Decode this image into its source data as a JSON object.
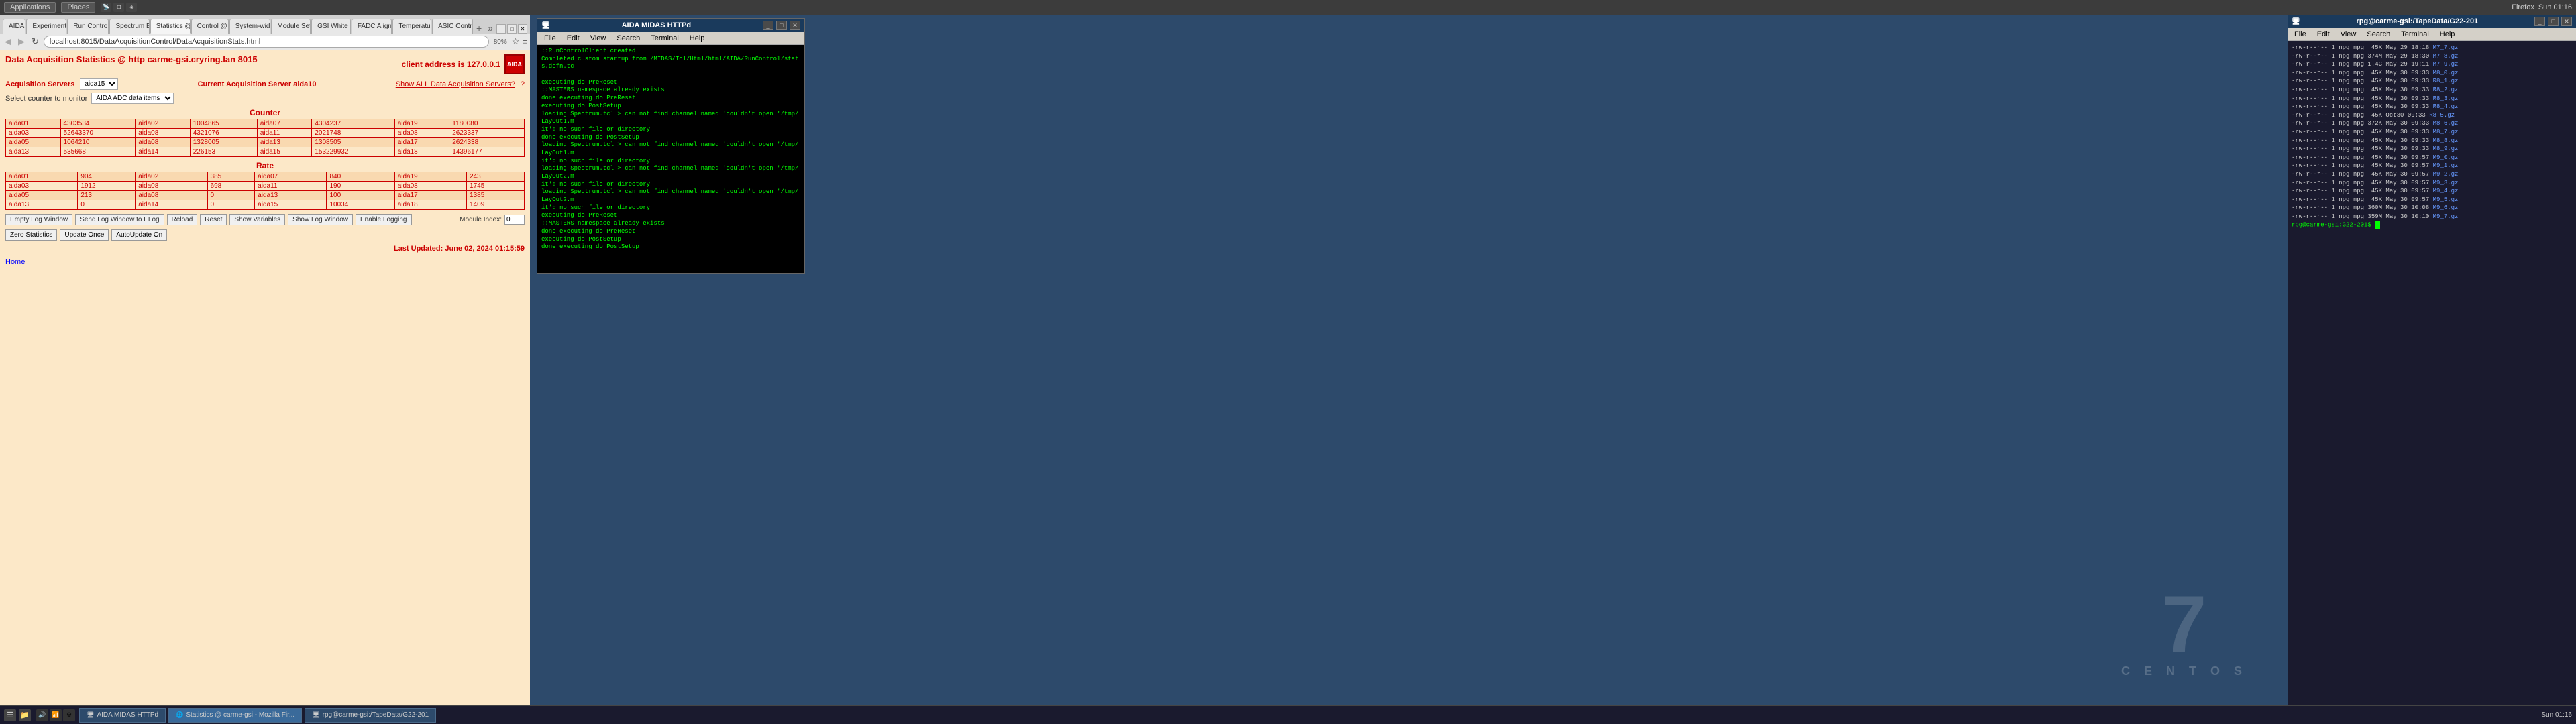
{
  "topbar": {
    "time": "Sun 01:16",
    "apps_label": "Applications",
    "places_label": "Places",
    "firefox_label": "Firefox"
  },
  "browser": {
    "tabs": [
      {
        "label": "AIDA",
        "active": false
      },
      {
        "label": "Experiment Cor...",
        "active": false
      },
      {
        "label": "Run Control @ c...",
        "active": false
      },
      {
        "label": "Spectrum Brow...",
        "active": false
      },
      {
        "label": "Statistics @ car...",
        "active": true
      },
      {
        "label": "Control @ car...",
        "active": false
      },
      {
        "label": "System-wide Ch...",
        "active": false
      },
      {
        "label": "Module Setting...",
        "active": false
      },
      {
        "label": "GSI White Rab...",
        "active": false
      },
      {
        "label": "FADC Align & C...",
        "active": false
      },
      {
        "label": "Temperature a...",
        "active": false
      },
      {
        "label": "ASIC Control @...",
        "active": false
      }
    ],
    "url": "localhost:8015/DataAcquisitionControl/DataAcquisitionStats.html",
    "zoom": "80%",
    "page_title": "Data Acquisition Statistics @ http carme-gsi.cryring.lan 8015",
    "client_address_label": "client address is 127.0.0.1",
    "acq_servers_label": "Acquisition Servers",
    "acq_server_value": "aida15",
    "current_server_label": "Current Acquisition Server aida10",
    "show_all_label": "Show ALL Data Acquisition Servers?",
    "monitor_label": "Select counter to monitor",
    "monitor_select": "AIDA ADC data items",
    "counter_section": "Counter",
    "rate_section": "Rate",
    "counter_rows": [
      [
        "aida01",
        "4303534",
        "aida02",
        "1004865",
        "aida07",
        "4304237",
        "aida19",
        "1180080"
      ],
      [
        "aida03",
        "52643370",
        "aida08",
        "4321076",
        "aida11",
        "2021748",
        "aida08",
        "2623337"
      ],
      [
        "aida05",
        "1064210",
        "aida08",
        "1328005",
        "aida13",
        "1308505",
        "aida17",
        "2624338"
      ],
      [
        "aida13",
        "535668",
        "aida14",
        "226153",
        "aida15",
        "153229932",
        "aida18",
        "14396177"
      ]
    ],
    "rate_rows": [
      [
        "aida01",
        "904",
        "aida02",
        "385",
        "aida07",
        "840",
        "aida19",
        "243"
      ],
      [
        "aida03",
        "1912",
        "aida08",
        "698",
        "aida11",
        "190",
        "aida08",
        "1745"
      ],
      [
        "aida05",
        "213",
        "aida08",
        "0",
        "aida13",
        "100",
        "aida17",
        "1385"
      ],
      [
        "aida13",
        "0",
        "aida14",
        "0",
        "aida15",
        "10034",
        "aida18",
        "1409"
      ]
    ],
    "buttons": [
      "Empty Log Window",
      "Send Log Window to ELog",
      "Reload",
      "Reset",
      "Show Variables",
      "Show Log Window",
      "Enable Logging"
    ],
    "module_index_label": "Module Index:",
    "module_index_value": "0",
    "zero_stats_btn": "Zero Statistics",
    "update_once_btn": "Update Once",
    "auto_update_btn": "AutoUpdate On",
    "last_updated": "Last Updated: June 02, 2024 01:15:59",
    "home_link": "Home"
  },
  "aida_window": {
    "title": "AIDA MIDAS HTTPd",
    "menu_items": [
      "File",
      "Edit",
      "View",
      "Search",
      "Terminal",
      "Help"
    ],
    "terminal_lines": [
      {
        "text": "::RunControlClient created",
        "type": "green"
      },
      {
        "text": "Completed custom startup from /MIDAS/Tcl/Html/html/AIDA/RunControl/stats.defn.tc",
        "type": "green"
      },
      {
        "text": "",
        "type": "green"
      },
      {
        "text": "executing do PreReset",
        "type": "green"
      },
      {
        "text": "::MASTERS namespace already exists",
        "type": "green"
      },
      {
        "text": "done executing do PreReset",
        "type": "green"
      },
      {
        "text": "executing do PostSetup",
        "type": "green"
      },
      {
        "text": "loading Spectrum.tcl > can not find channel named 'couldn't open '/tmp/LayOut1.m",
        "type": "green"
      },
      {
        "text": "it': no such file or directory",
        "type": "green"
      },
      {
        "text": "done executing do PostSetup",
        "type": "green"
      },
      {
        "text": "loading Spectrum.tcl > can not find channel named 'couldn't open '/tmp/LayOut1.m",
        "type": "green"
      },
      {
        "text": "it': no such file or directory",
        "type": "green"
      },
      {
        "text": "loading Spectrum.tcl > can not find channel named 'couldn't open '/tmp/LayOut2.m",
        "type": "green"
      },
      {
        "text": "it': no such file or directory",
        "type": "green"
      },
      {
        "text": "loading Spectrum.tcl > can not find channel named 'couldn't open '/tmp/LayOut2.m",
        "type": "green"
      },
      {
        "text": "it': no such file or directory",
        "type": "green"
      },
      {
        "text": "executing do PreReset",
        "type": "green"
      },
      {
        "text": "::MASTERS namespace already exists",
        "type": "green"
      },
      {
        "text": "done executing do PreReset",
        "type": "green"
      },
      {
        "text": "executing do PostSetup",
        "type": "green"
      },
      {
        "text": "done executing do PostSetup",
        "type": "green"
      }
    ]
  },
  "right_terminal": {
    "title": "rpg@carme-gsi:/TapeData/G22-201",
    "menu_items": [
      "File",
      "Edit",
      "View",
      "Search",
      "Terminal",
      "Help"
    ],
    "prompt": "rpg@carme-gsi:G22-201",
    "file_lines": [
      "-rw-r--r-- 1 npg npg  45K May 29 18:18 M7_7.gz",
      "-rw-r--r-- 1 npg npg 374M May 29 18:30 M7_8.gz",
      "-rw-r--r-- 1 npg npg 1.4G May 29 19:11 M7_9.gz",
      "-rw-r--r-- 1 npg npg  45K May 30 09:33 M8_0.gz",
      "-rw-r--r-- 1 npg npg  45K May 30 09:33 R8_1.gz",
      "-rw-r--r-- 1 npg npg  45K May 30 09:33 R8_2.gz",
      "-rw-r--r-- 1 npg npg  45K May 30 09:33 R8_3.gz",
      "-rw-r--r-- 1 npg npg  45K May 30 09:33 R8_4.gz",
      "-rw-r--r-- 1 npg npg  45K Oct30 09:33 R8_5.gz",
      "-rw-r--r-- 1 npg npg 372K May 30 09:33 M8_6.gz",
      "-rw-r--r-- 1 npg npg  45K May 30 09:33 M8_7.gz",
      "-rw-r--r-- 1 npg npg  45K May 30 09:33 M8_8.gz",
      "-rw-r--r-- 1 npg npg  45K May 30 09:33 M8_9.gz",
      "-rw-r--r-- 1 npg npg  45K May 30 09:57 M9_0.gz",
      "-rw-r--r-- 1 npg npg  45K May 30 09:57 M9_1.gz",
      "-rw-r--r-- 1 npg npg  45K May 30 09:57 M9_2.gz",
      "-rw-r--r-- 1 npg npg  45K May 30 09:57 M9_3.gz",
      "-rw-r--r-- 1 npg npg  45K May 30 09:57 M9_4.gz",
      "-rw-r--r-- 1 npg npg  45K May 30 09:57 M9_5.gz",
      "-rw-r--r-- 1 npg npg 360M May 30 10:08 M9_6.gz",
      "-rw-r--r-- 1 npg npg 359M May 30 10:10 M9_7.gz",
      "rpg@carme-gsi:G22-201$"
    ]
  },
  "desktop": {
    "centos_number": "7",
    "centos_text": "C E N T O S"
  },
  "taskbar": {
    "apps_label": "Applications",
    "places_label": "Places",
    "items": [
      {
        "label": "AIDA MIDAS HTTPd",
        "active": false
      },
      {
        "label": "Statistics @ carme-gsi - Mozilla Fir...",
        "active": true
      },
      {
        "label": "rpg@carme-gsi:/TapeData/G22-201",
        "active": false
      }
    ],
    "time": "Sun 01:16"
  }
}
